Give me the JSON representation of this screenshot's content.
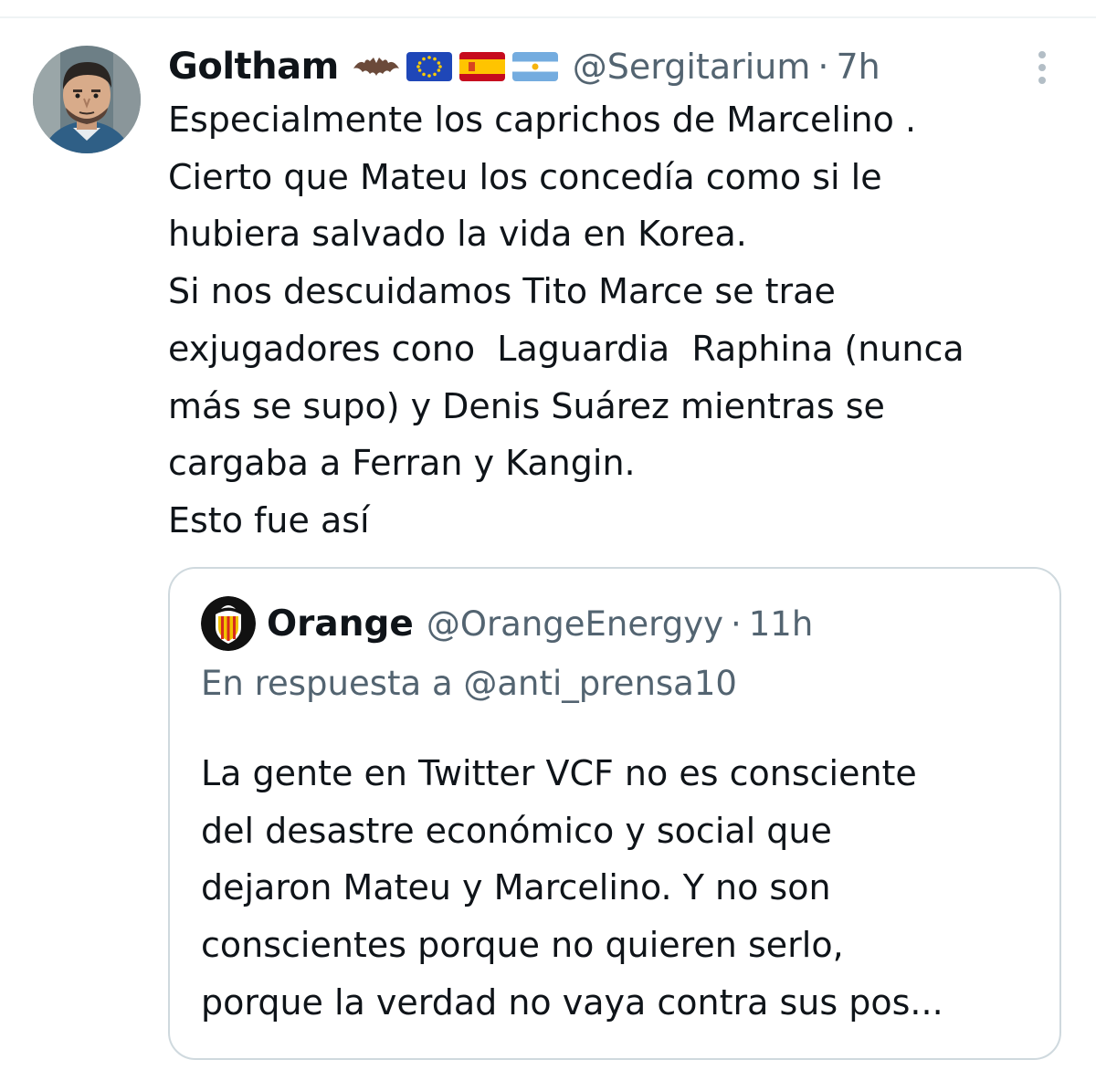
{
  "tweet": {
    "display_name": "Goltham",
    "badges": [
      "bat-emoji",
      "eu-flag",
      "spain-flag",
      "argentina-flag"
    ],
    "handle": "@Sergitarium",
    "separator": "·",
    "time": "7h",
    "lines": [
      "Especialmente los caprichos de Marcelino .",
      "Cierto que Mateu los concedía como si le",
      "hubiera salvado la vida en Korea.",
      "Si nos descuidamos Tito Marce se trae",
      "exjugadores cono  Laguardia  Raphina (nunca",
      "más se supo) y Denis Suárez mientras se",
      "cargaba a Ferran y Kangin.",
      "Esto fue así"
    ]
  },
  "quote": {
    "display_name": "Orange",
    "handle": "@OrangeEnergyy",
    "separator": "·",
    "time": "11h",
    "reply_to": "En respuesta a @anti_prensa10",
    "lines": [
      "La gente en Twitter VCF no es consciente",
      "del desastre económico y social que",
      "dejaron Mateu y Marcelino. Y no son",
      "conscientes porque no quieren serlo,",
      "porque la verdad no vaya contra sus pos..."
    ]
  },
  "colors": {
    "text_primary": "#0f1419",
    "text_secondary": "#536471",
    "border": "#cfd9de"
  }
}
